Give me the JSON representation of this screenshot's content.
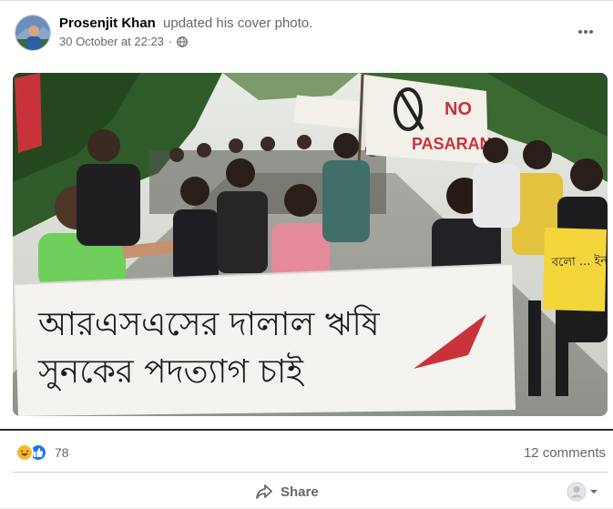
{
  "post": {
    "author": "Prosenjit Khan",
    "action": "updated his cover photo.",
    "timestamp": "30 October at 22:23",
    "privacy_icon": "globe-icon",
    "more_icon": "more-options-icon"
  },
  "photo": {
    "banner_line1": "আরএসএসের দালাল ঋষি",
    "banner_line2": "সুনকের পদত্যাগ চাই",
    "flag_text_top": "NO",
    "flag_text_bottom": "PASARAN",
    "placard_text": "বলো ... ইনকেলাব"
  },
  "footer": {
    "reaction_icons": [
      "haha-icon",
      "like-icon"
    ],
    "reaction_count": "78",
    "comments": "12 comments",
    "share_label": "Share",
    "share_icon": "share-arrow-icon",
    "viewer_icon": "viewer-avatar-icon"
  },
  "colors": {
    "text_primary": "#050505",
    "text_secondary": "#65676b",
    "like_blue": "#1877f2",
    "haha_yellow": "#f7b928",
    "divider": "#ced0d4"
  }
}
